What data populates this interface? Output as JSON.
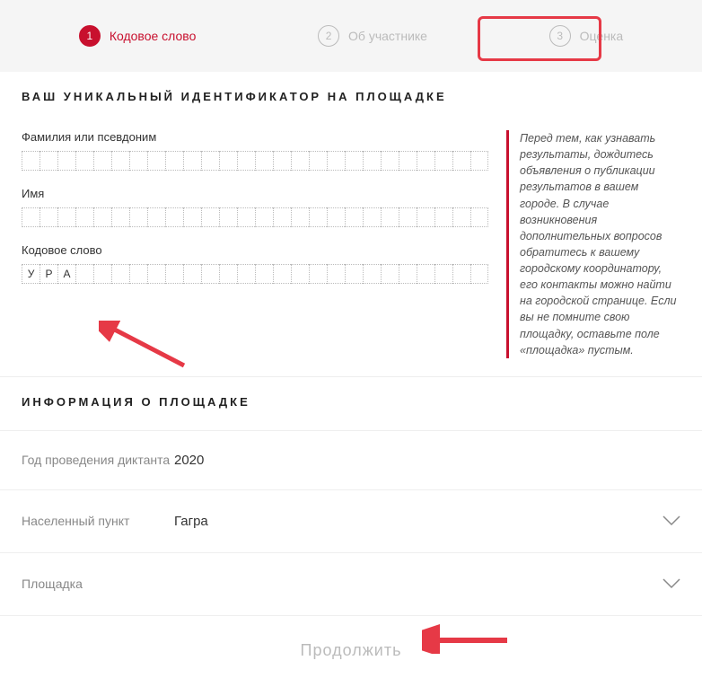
{
  "stepper": {
    "steps": [
      {
        "num": "1",
        "label": "Кодовое слово",
        "active": true
      },
      {
        "num": "2",
        "label": "Об участнике",
        "active": false
      },
      {
        "num": "3",
        "label": "Оценка",
        "active": false
      }
    ]
  },
  "identifier": {
    "title": "ВАШ УНИКАЛЬНЫЙ ИДЕНТИФИКАТОР НА ПЛОЩАДКЕ",
    "surname_label": "Фамилия или псевдоним",
    "name_label": "Имя",
    "codeword_label": "Кодовое слово",
    "codeword_chars": [
      "У",
      "Р",
      "А"
    ],
    "hint": "Перед тем, как узнавать результаты, дождитесь объявления о публикации результатов в вашем городе. В случае возникновения дополнительных вопросов обратитесь к вашему городскому координатору, его контакты можно найти на городской странице. Если вы не помните свою площадку, оставьте поле «площадка» пустым."
  },
  "venue": {
    "title": "ИНФОРМАЦИЯ О ПЛОЩАДКЕ",
    "year_label": "Год проведения диктанта",
    "year_value": "2020",
    "city_label": "Населенный пункт",
    "city_value": "Гагра",
    "place_label": "Площадка",
    "place_value": ""
  },
  "continue_label": "Продолжить"
}
